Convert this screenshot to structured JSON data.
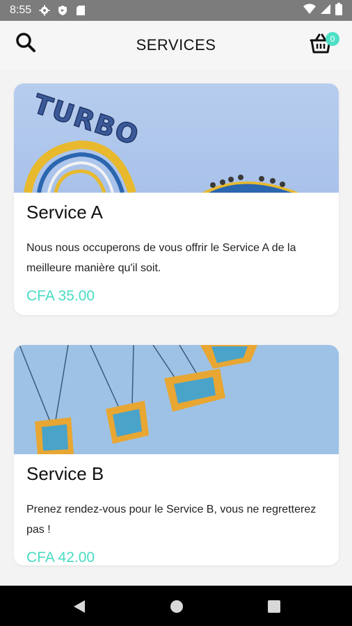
{
  "status_bar": {
    "time": "8:55",
    "left_icons": [
      "settings-icon",
      "shield-icon",
      "sim-card-icon"
    ],
    "right_icons": [
      "wifi-icon",
      "signal-icon",
      "battery-icon"
    ]
  },
  "app_bar": {
    "title": "SERVICES",
    "search_icon": "search-icon",
    "cart_icon": "basket-icon",
    "cart_count": "0",
    "accent": "#4ee0c6"
  },
  "services": [
    {
      "name": "Service A",
      "description": "Nous nous occuperons de vous offrir le Service A de la meilleure manière qu'il soit.",
      "price": "CFA 35.00",
      "image_sign_text": "TURBO"
    },
    {
      "name": "Service B",
      "description": "Prenez rendez-vous pour le Service B, vous ne regretterez pas !",
      "price": "CFA 42.00"
    }
  ],
  "nav_bar": {
    "buttons": [
      "back-icon",
      "home-icon",
      "recents-icon"
    ]
  }
}
